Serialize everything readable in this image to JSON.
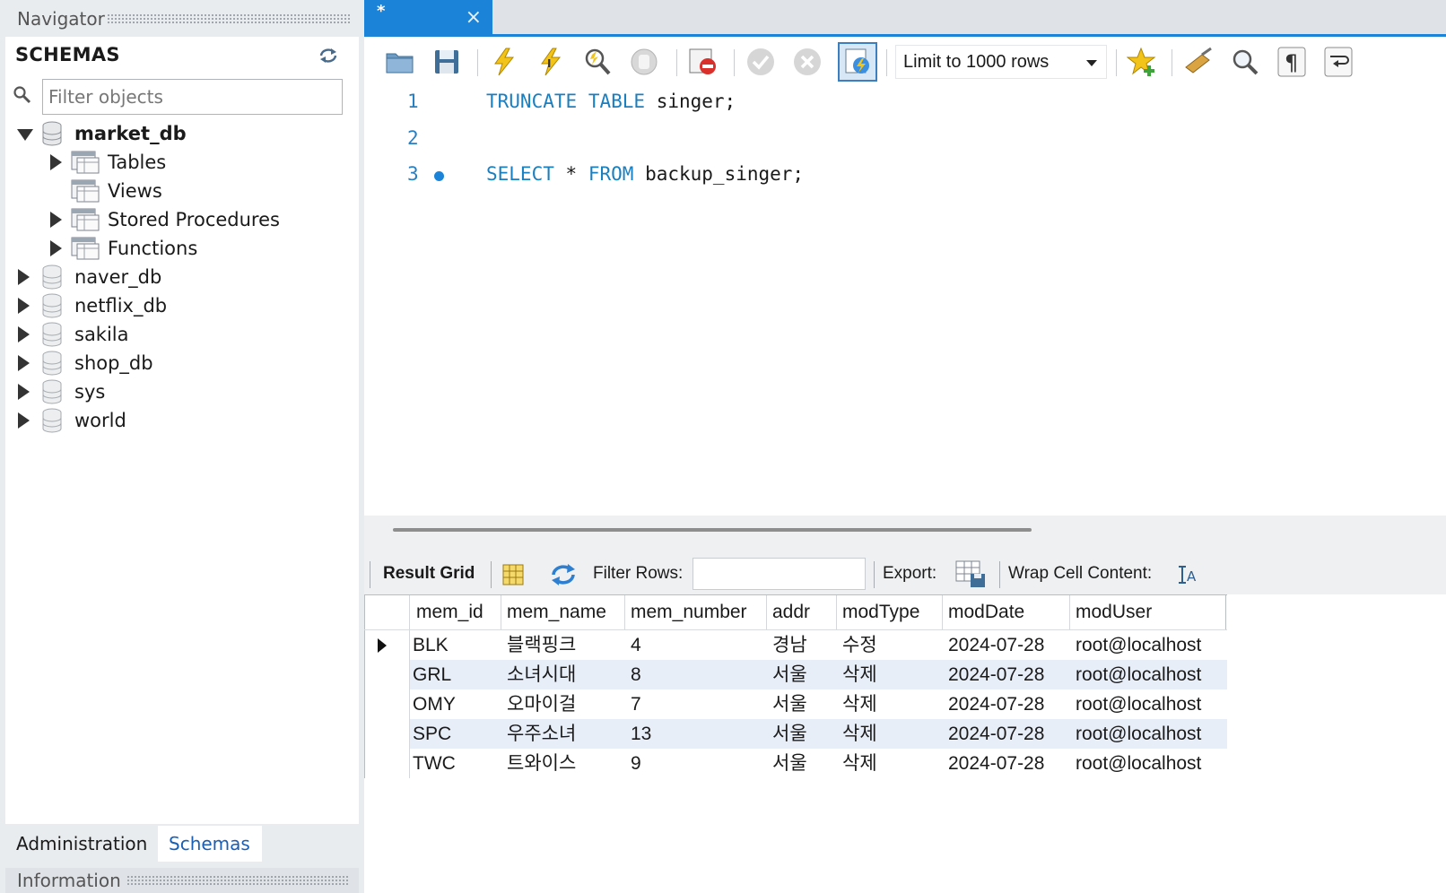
{
  "navigator": {
    "title": "Navigator",
    "schemas_title": "SCHEMAS",
    "filter_placeholder": "Filter objects",
    "tree": [
      {
        "label": "market_db",
        "expanded": true,
        "bold": true,
        "children": [
          "Tables",
          "Views",
          "Stored Procedures",
          "Functions"
        ]
      },
      {
        "label": "naver_db"
      },
      {
        "label": "netflix_db"
      },
      {
        "label": "sakila"
      },
      {
        "label": "shop_db"
      },
      {
        "label": "sys"
      },
      {
        "label": "world"
      }
    ],
    "bottom_tabs": [
      "Administration",
      "Schemas"
    ],
    "active_bottom_tab": "Schemas",
    "info_title": "Information"
  },
  "editor_tab": {
    "name": "*",
    "close": "×"
  },
  "toolbar": {
    "limit_label": "Limit to 1000 rows",
    "icons": [
      "open-folder-icon",
      "save-icon",
      "execute-icon",
      "execute-current-icon",
      "explain-icon",
      "stop-icon",
      "toggle-error-icon",
      "commit-icon",
      "rollback-icon",
      "autocommit-icon",
      "add-snippet-icon",
      "beautify-icon",
      "find-icon",
      "invisible-chars-icon",
      "wrap-icon"
    ]
  },
  "code": {
    "line_numbers": [
      "1",
      "2",
      "3"
    ],
    "line1": {
      "kw1": "TRUNCATE",
      "kw2": "TABLE",
      "ident": "singer;"
    },
    "line3": {
      "kw1": "SELECT",
      "star": "*",
      "kw2": "FROM",
      "ident": "backup_singer;"
    }
  },
  "result_toolbar": {
    "result_grid": "Result Grid",
    "filter_rows": "Filter Rows:",
    "export": "Export:",
    "wrap": "Wrap Cell Content:"
  },
  "grid": {
    "columns": [
      "mem_id",
      "mem_name",
      "mem_number",
      "addr",
      "modType",
      "modDate",
      "modUser"
    ],
    "rows": [
      [
        "BLK",
        "블랙핑크",
        "4",
        "경남",
        "수정",
        "2024-07-28",
        "root@localhost"
      ],
      [
        "GRL",
        "소녀시대",
        "8",
        "서울",
        "삭제",
        "2024-07-28",
        "root@localhost"
      ],
      [
        "OMY",
        "오마이걸",
        "7",
        "서울",
        "삭제",
        "2024-07-28",
        "root@localhost"
      ],
      [
        "SPC",
        "우주소녀",
        "13",
        "서울",
        "삭제",
        "2024-07-28",
        "root@localhost"
      ],
      [
        "TWC",
        "트와이스",
        "9",
        "서울",
        "삭제",
        "2024-07-28",
        "root@localhost"
      ]
    ]
  },
  "colors": {
    "accent": "#1c84d8",
    "keyword": "#1a7fc0",
    "alt_row": "#e8eef8"
  }
}
